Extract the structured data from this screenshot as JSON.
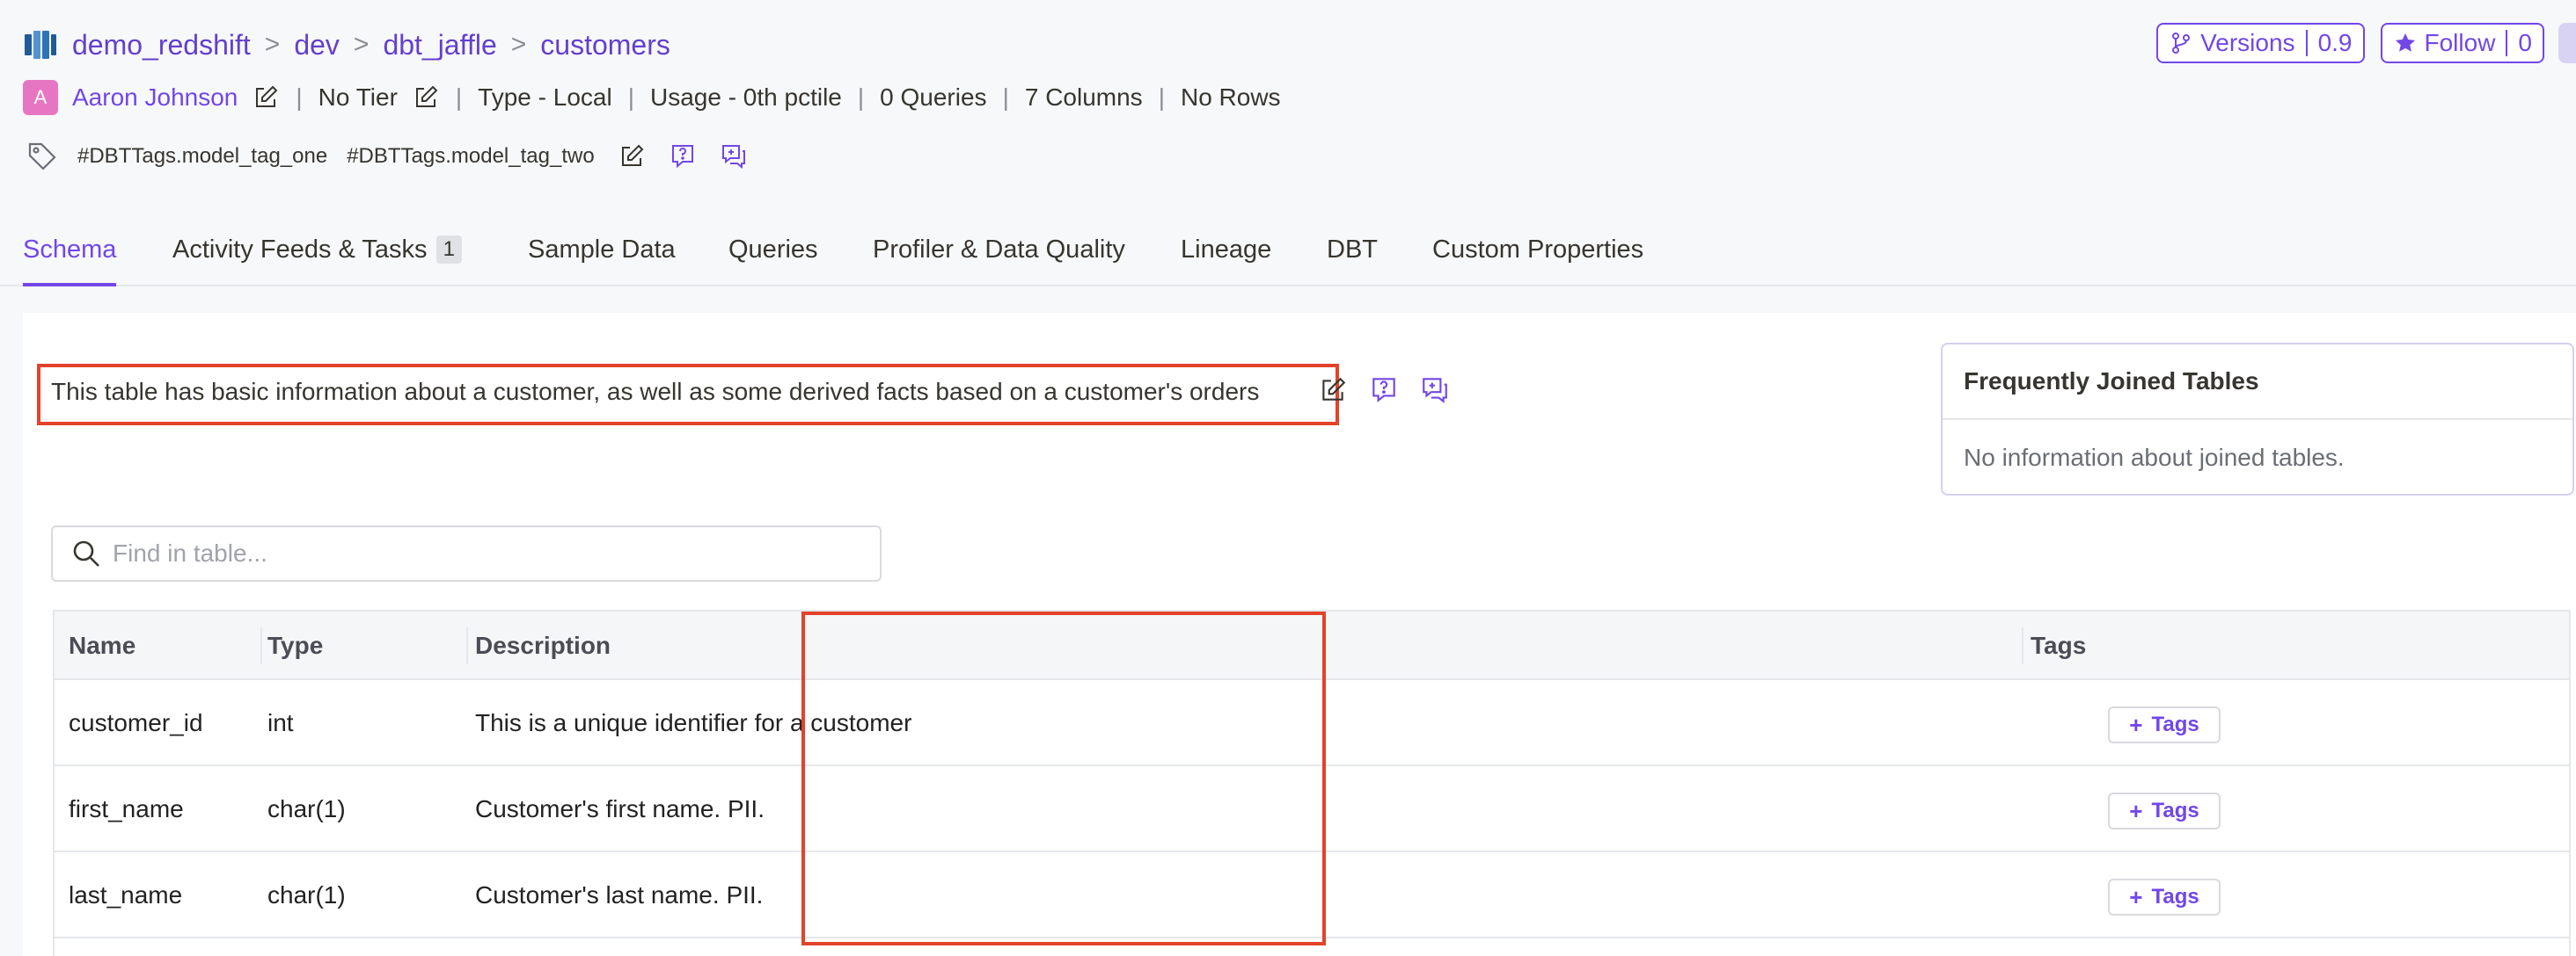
{
  "breadcrumb": {
    "service": "demo_redshift",
    "database": "dev",
    "schema": "dbt_jaffle",
    "table": "customers",
    "separator": ">"
  },
  "header_actions": {
    "versions_label": "Versions",
    "versions_value": "0.9",
    "follow_label": "Follow",
    "follow_value": "0"
  },
  "meta": {
    "owner_initial": "A",
    "owner": "Aaron Johnson",
    "tier": "No Tier",
    "type": "Type -  Local",
    "usage": "Usage - 0th pctile",
    "queries": "0 Queries",
    "columns": "7 Columns",
    "rows": "No Rows",
    "separator": "|"
  },
  "tags": [
    "#DBTTags.model_tag_one",
    "#DBTTags.model_tag_two"
  ],
  "tabs": [
    {
      "label": "Schema",
      "active": true
    },
    {
      "label": "Activity Feeds & Tasks",
      "badge": "1"
    },
    {
      "label": "Sample Data"
    },
    {
      "label": "Queries"
    },
    {
      "label": "Profiler & Data Quality"
    },
    {
      "label": "Lineage"
    },
    {
      "label": "DBT"
    },
    {
      "label": "Custom Properties"
    }
  ],
  "description": "This table has basic information about a customer, as well as some derived facts based on a customer's orders",
  "frequently_joined": {
    "title": "Frequently Joined Tables",
    "empty": "No information about joined tables."
  },
  "search": {
    "placeholder": "Find in table..."
  },
  "table": {
    "headers": [
      "Name",
      "Type",
      "Description",
      "Tags"
    ],
    "rows": [
      {
        "name": "customer_id",
        "type": "int",
        "description": "This is a unique identifier for a customer",
        "tags_label": "Tags"
      },
      {
        "name": "first_name",
        "type": "char(1)",
        "description": "Customer's first name. PII.",
        "tags_label": "Tags"
      },
      {
        "name": "last_name",
        "type": "char(1)",
        "description": "Customer's last name. PII.",
        "tags_label": "Tags"
      }
    ]
  },
  "colors": {
    "accent": "#7147e8",
    "highlight": "#e2432a"
  }
}
